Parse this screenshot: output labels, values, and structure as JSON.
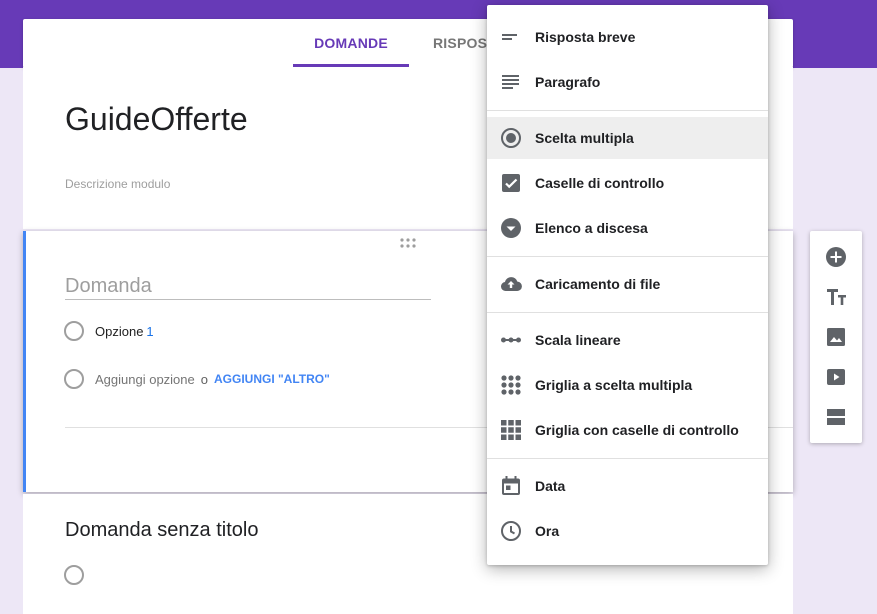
{
  "tabs": {
    "questions": "DOMANDE",
    "responses": "RISPOST"
  },
  "form": {
    "title": "GuideOfferte",
    "description_placeholder": "Descrizione modulo"
  },
  "question_card": {
    "question_placeholder": "Domanda",
    "option1_label": "Opzione",
    "option1_number": "1",
    "add_option": "Aggiungi opzione",
    "or_text": "o",
    "add_other": "AGGIUNGI \"ALTRO\""
  },
  "second_card": {
    "title": "Domanda senza titolo"
  },
  "menu": {
    "items": [
      {
        "label": "Risposta breve",
        "icon": "short-answer-icon"
      },
      {
        "label": "Paragrafo",
        "icon": "paragraph-icon"
      },
      {
        "label": "Scelta multipla",
        "icon": "radio-button-icon",
        "selected": true
      },
      {
        "label": "Caselle di controllo",
        "icon": "checkbox-icon"
      },
      {
        "label": "Elenco a discesa",
        "icon": "dropdown-icon"
      },
      {
        "label": "Caricamento di file",
        "icon": "cloud-upload-icon"
      },
      {
        "label": "Scala lineare",
        "icon": "linear-scale-icon"
      },
      {
        "label": "Griglia a scelta multipla",
        "icon": "multiple-choice-grid-icon"
      },
      {
        "label": "Griglia con caselle di controllo",
        "icon": "checkbox-grid-icon"
      },
      {
        "label": "Data",
        "icon": "calendar-icon"
      },
      {
        "label": "Ora",
        "icon": "clock-icon"
      }
    ]
  },
  "toolbar": {
    "buttons": [
      "add-question-icon",
      "title-text-icon",
      "image-icon",
      "video-icon",
      "section-icon"
    ]
  },
  "colors": {
    "accent": "#673ab7",
    "background": "#ede7f6",
    "link": "#4285f4"
  }
}
